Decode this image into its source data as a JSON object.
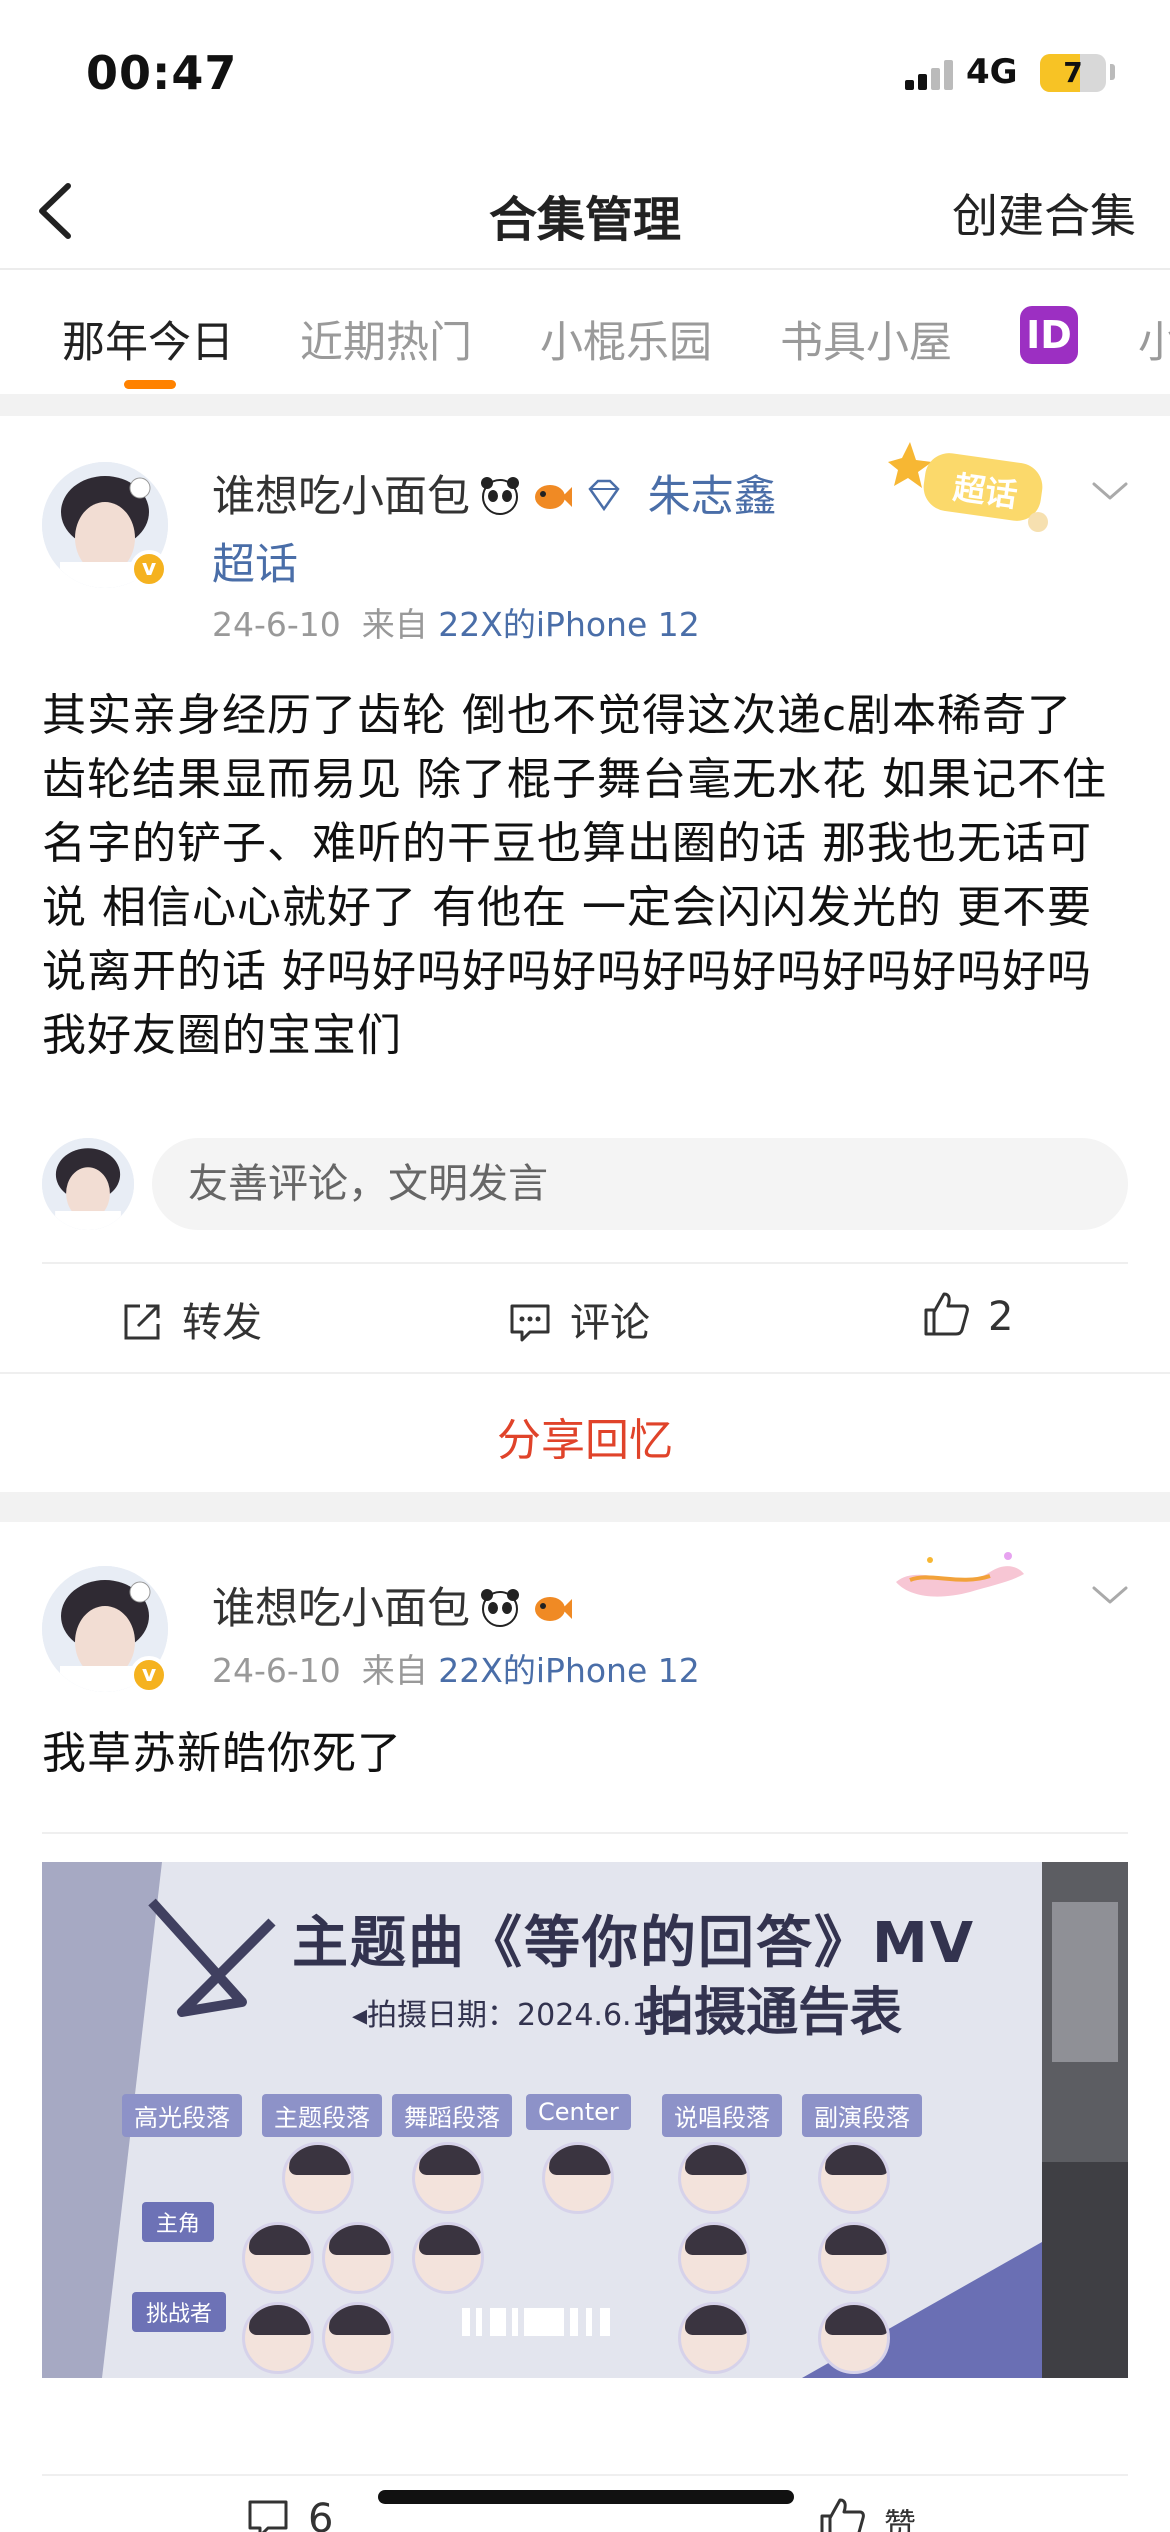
{
  "status_bar": {
    "time": "00:47",
    "network": "4G",
    "battery": "7"
  },
  "nav": {
    "title": "合集管理",
    "action": "创建合集"
  },
  "tabs": [
    {
      "label": "那年今日",
      "active": true
    },
    {
      "label": "近期热门"
    },
    {
      "label": "小棍乐园"
    },
    {
      "label": "书具小屋"
    },
    {
      "label": "ID"
    },
    {
      "label": "小"
    }
  ],
  "posts": [
    {
      "user_name": "谁想吃小面包",
      "topic": "朱志鑫",
      "topic_suffix": "超话",
      "date": "24-6-10",
      "source_prefix": "来自",
      "device": "22X的iPhone 12",
      "text": "其实亲身经历了齿轮 倒也不觉得这次递c剧本稀奇了 齿轮结果显而易见 除了棍子舞台毫无水花 如果记不住名字的铲子、难听的干豆也算出圈的话 那我也无话可说 相信心心就好了 有他在 一定会闪闪发光的 更不要说离开的话 好吗好吗好吗好吗好吗好吗好吗好吗好吗我好友圈的宝宝们",
      "sticker": "超话",
      "comment_placeholder": "友善评论，文明发言",
      "actions": {
        "repost": "转发",
        "comment": "评论",
        "like_count": "2"
      },
      "share_memory": "分享回忆"
    },
    {
      "user_name": "谁想吃小面包",
      "date": "24-6-10",
      "source_prefix": "来自",
      "device": "22X的iPhone 12",
      "text": "我草苏新皓你死了",
      "image": {
        "title": "主题曲《等你的回答》MV",
        "subtitle": "拍摄通告表",
        "date_line": "◂拍摄日期：2024.6.10▸",
        "columns": [
          "高光段落",
          "主题段落",
          "舞蹈段落",
          "Center",
          "说唱段落",
          "副演段落"
        ],
        "rows": [
          "主角",
          "挑战者"
        ]
      },
      "actions": {
        "comment_count": "6",
        "like_label": "赞"
      }
    }
  ]
}
